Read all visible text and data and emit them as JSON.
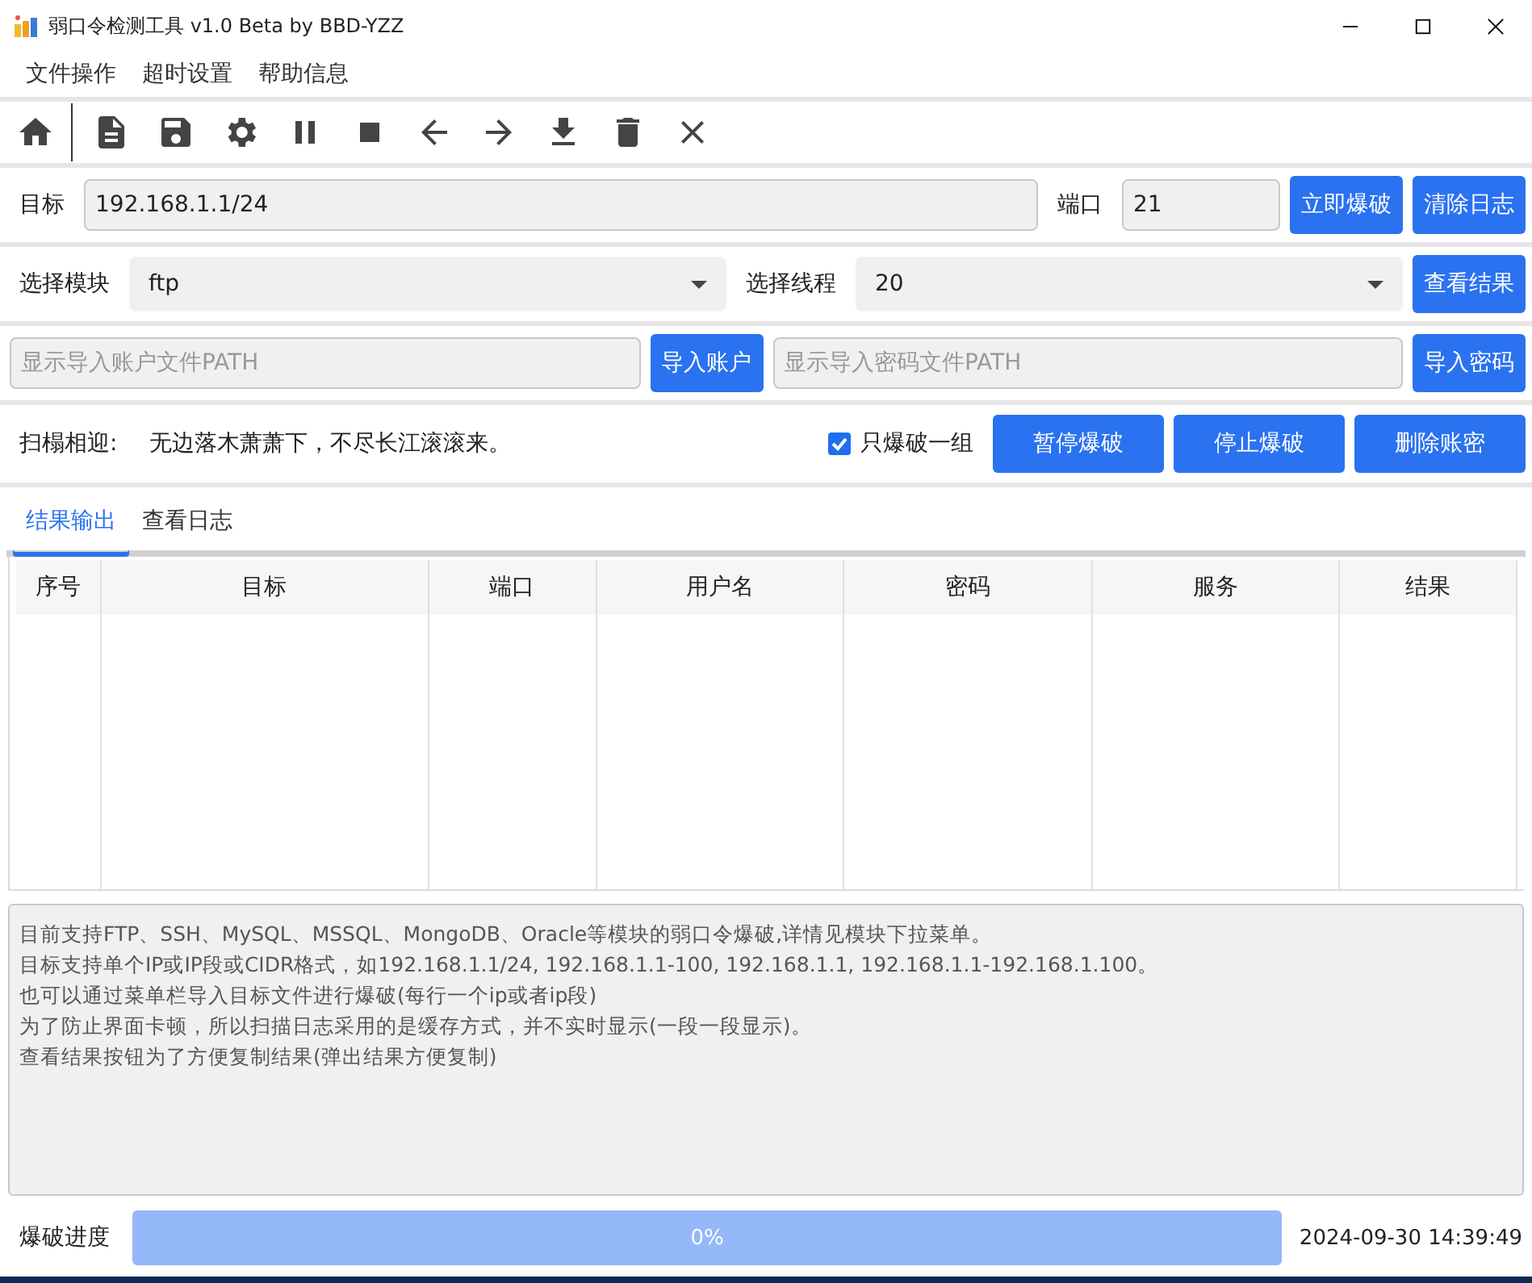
{
  "window": {
    "title": "弱口令检测工具 v1.0 Beta by BBD-YZZ"
  },
  "menu": [
    "文件操作",
    "超时设置",
    "帮助信息"
  ],
  "toolbar": [
    {
      "kind": "home"
    },
    {
      "kind": "sep"
    },
    {
      "kind": "file"
    },
    {
      "kind": "save"
    },
    {
      "kind": "gear"
    },
    {
      "kind": "pause"
    },
    {
      "kind": "stop"
    },
    {
      "kind": "left"
    },
    {
      "kind": "right"
    },
    {
      "kind": "download"
    },
    {
      "kind": "trash"
    },
    {
      "kind": "close"
    }
  ],
  "target": {
    "label": "目标",
    "value": "192.168.1.1/24",
    "port_label": "端口",
    "port": "21",
    "buttons": [
      "立即爆破",
      "清除日志"
    ]
  },
  "module": {
    "label": "选择模块",
    "value": "ftp",
    "threads_label": "选择线程",
    "threads": "20",
    "button": "查看结果"
  },
  "imports": {
    "account_placeholder": "显示导入账户文件PATH",
    "account_button": "导入账户",
    "password_placeholder": "显示导入密码文件PATH",
    "password_button": "导入密码"
  },
  "status": {
    "label": "扫榻相迎:",
    "message": "无边落木萧萧下，不尽长江滚滚来。",
    "checkbox": {
      "label": "只爆破一组",
      "checked": true
    },
    "buttons": [
      "暂停爆破",
      "停止爆破",
      "删除账密"
    ]
  },
  "tabs": [
    {
      "label": "结果输出",
      "selected": true
    },
    {
      "label": "查看日志",
      "selected": false
    }
  ],
  "table": {
    "columns": [
      "序号",
      "目标",
      "端口",
      "用户名",
      "密码",
      "服务",
      "结果"
    ]
  },
  "log": [
    "目前支持FTP、SSH、MySQL、MSSQL、MongoDB、Oracle等模块的弱口令爆破,详情见模块下拉菜单。",
    "目标支持单个IP或IP段或CIDR格式，如192.168.1.1/24, 192.168.1.1-100, 192.168.1.1, 192.168.1.1-192.168.1.100。",
    "也可以通过菜单栏导入目标文件进行爆破(每行一个ip或者ip段)",
    "为了防止界面卡顿，所以扫描日志采用的是缓存方式，并不实时显示(一段一段显示)。",
    "查看结果按钮为了方便复制结果(弹出结果方便复制)"
  ],
  "progress": {
    "label": "爆破进度",
    "level": 0,
    "reading": "0%"
  },
  "status_bar": {
    "time": "2024-09-30 14:39:49"
  }
}
